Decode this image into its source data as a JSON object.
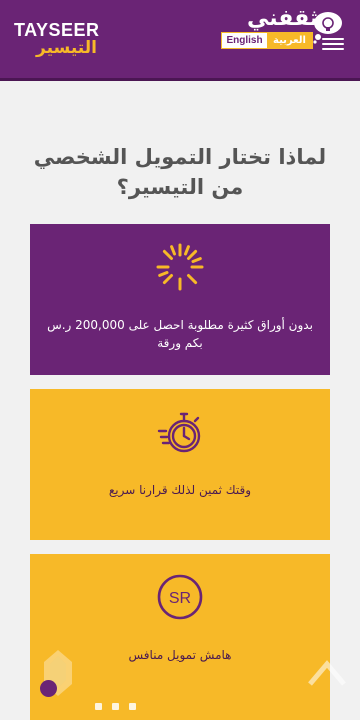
{
  "header": {
    "logo_en": "TAYSEER",
    "logo_ar": "التيسير",
    "brand_ar": "ثقفني",
    "lang_en": "English",
    "lang_ar": "العربية"
  },
  "main": {
    "heading": "لماذا تختار التمويل الشخصي من التيسير؟",
    "cards": [
      {
        "icon": "sunburst-icon",
        "text": "بدون أوراق كثيرة مطلوبة احصل على 200,000 ر.س بكم ورقة"
      },
      {
        "icon": "stopwatch-icon",
        "text": "وقتك ثمين لذلك قرارنا سريع"
      },
      {
        "icon": "sr-currency-icon",
        "text": "هامش تمويل منافس",
        "icon_text": "SR"
      }
    ]
  },
  "colors": {
    "purple": "#6a2475",
    "yellow": "#f7b928",
    "background": "#f1f1f1"
  }
}
